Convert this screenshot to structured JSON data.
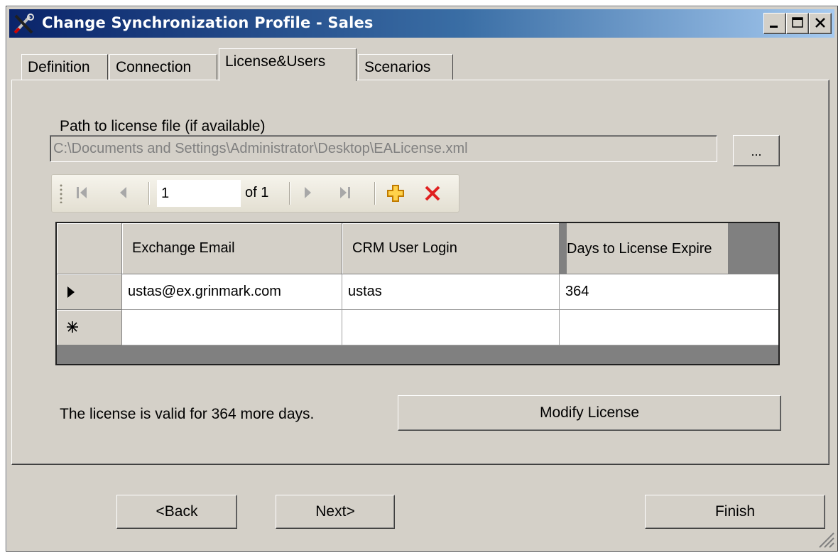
{
  "window": {
    "title": "Change Synchronization Profile - Sales"
  },
  "tabs": [
    {
      "label": "Definition"
    },
    {
      "label": "Connection"
    },
    {
      "label": "License&Users"
    },
    {
      "label": "Scenarios"
    }
  ],
  "license_path": {
    "label": "Path to license file (if available)",
    "value": "C:\\Documents and Settings\\Administrator\\Desktop\\EALicense.xml",
    "browse_label": "..."
  },
  "navigator": {
    "position": "1",
    "of_label": "of 1"
  },
  "grid": {
    "columns": [
      "Exchange Email",
      "CRM User Login",
      "Days to License Expire"
    ],
    "rows": [
      {
        "indicator": "current-row",
        "email": "ustas@ex.grinmark.com",
        "login": "ustas",
        "days": "364"
      },
      {
        "indicator": "new-row",
        "email": "",
        "login": "",
        "days": ""
      }
    ]
  },
  "license_status": "The license is valid for 364 more days.",
  "modify_button": "Modify License",
  "buttons": {
    "back": "<Back",
    "next": "Next>",
    "finish": "Finish"
  },
  "icons": [
    "app-tools-icon",
    "minimize-icon",
    "maximize-icon",
    "close-icon",
    "move-first-icon",
    "move-previous-icon",
    "move-next-icon",
    "move-last-icon",
    "add-new-icon",
    "delete-icon",
    "row-pointer-icon",
    "new-row-asterisk-icon"
  ]
}
